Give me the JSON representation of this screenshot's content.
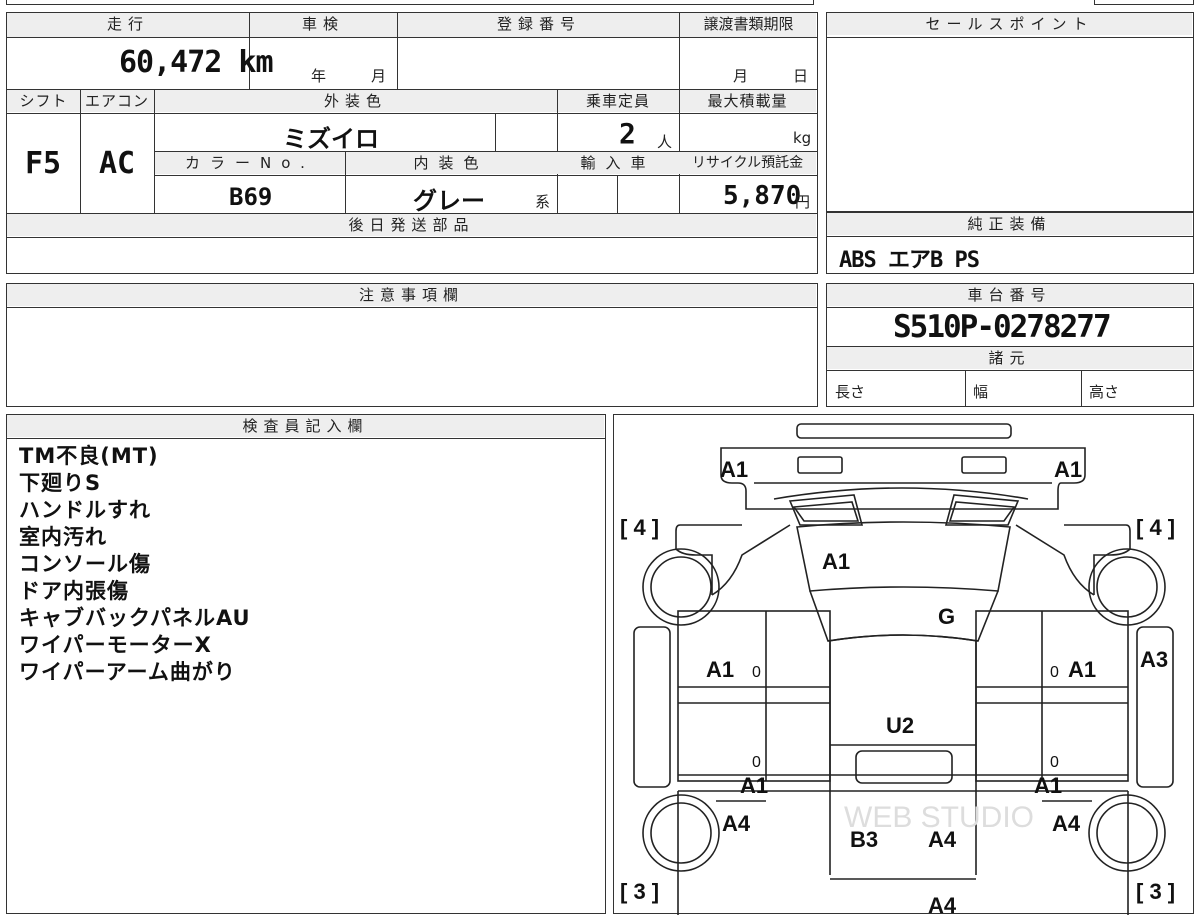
{
  "vehicle": {
    "mileage_label": "走行",
    "mileage_value": "60,472 km",
    "inspection_label": "車検",
    "inspection_year_unit": "年",
    "inspection_month_unit": "月",
    "registration_label": "登録番号",
    "transfer_deadline_label": "譲渡書類期限",
    "transfer_month_unit": "月",
    "transfer_day_unit": "日",
    "shift_label": "シフト",
    "shift_value": "F5",
    "ac_label": "エアコン",
    "ac_value": "AC",
    "exterior_color_label": "外装色",
    "exterior_color_value": "ミズイロ",
    "capacity_label": "乗車定員",
    "capacity_value": "2",
    "capacity_unit": "人",
    "max_load_label": "最大積載量",
    "max_load_unit": "kg",
    "color_no_label": "カラーNo.",
    "color_no_value": "B69",
    "interior_color_label": "内装色",
    "interior_color_value": "グレー",
    "interior_color_suffix": "系",
    "import_label": "輸入車",
    "recycle_label": "リサイクル預託金",
    "recycle_value": "5,870",
    "recycle_unit": "円",
    "later_parts_label": "後日発送部品",
    "notes_label": "注意事項欄",
    "sales_point_label": "セールスポイント",
    "genuine_equipment_label": "純正装備",
    "genuine_equipment_value": "ABS エアB PS",
    "chassis_label": "車台番号",
    "chassis_value": "S510P-0278277",
    "specs_label": "諸元",
    "length_label": "長さ",
    "width_label": "幅",
    "height_label": "高さ"
  },
  "inspector": {
    "label": "検査員記入欄",
    "notes": [
      "TM不良(MT)",
      "下廻りS",
      "ハンドルすれ",
      "室内汚れ",
      "コンソール傷",
      "ドア内張傷",
      "キャブバックパネルAU",
      "ワイパーモーターX",
      "ワイパーアーム曲がり"
    ]
  },
  "diagram": {
    "tire_front_left": "[ 4 ]",
    "tire_front_right": "[ 4 ]",
    "tire_rear_left": "[ 3 ]",
    "tire_rear_right": "[ 3 ]",
    "marks": {
      "front_left_corner": "A1",
      "front_right_corner": "A1",
      "windshield": "A1",
      "hood": "G",
      "left_front_door": "A1",
      "right_front_door": "A1",
      "right_side_edge": "A3",
      "roof": "U2",
      "left_step_zero_top": "0",
      "right_step_zero_top": "0",
      "left_step_zero_mid": "0",
      "right_step_zero_mid": "0",
      "left_lower_sill": "A1",
      "right_lower_sill": "A1",
      "left_rear_panel": "A4",
      "right_rear_panel": "A4",
      "bed_left": "B3",
      "bed_right": "A4",
      "bed_bottom": "A4"
    },
    "watermark": "WEB STUDIO"
  }
}
